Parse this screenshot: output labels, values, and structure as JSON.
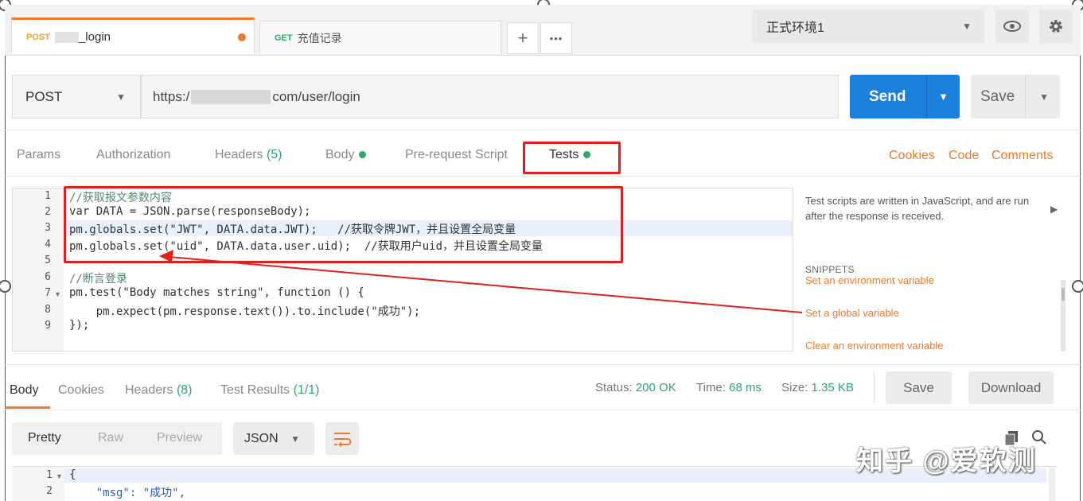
{
  "tabs": [
    {
      "method": "POST",
      "name": "_login",
      "unsaved": true
    },
    {
      "method": "GET",
      "name": "充值记录"
    }
  ],
  "tab_actions": {
    "add": "+",
    "more": "•••"
  },
  "environment": {
    "selected": "正式环境1"
  },
  "request": {
    "method": "POST",
    "url_prefix": "https:/",
    "url_suffix": "com/user/login",
    "send_label": "Send",
    "save_label": "Save"
  },
  "request_tabs": {
    "params": "Params",
    "authorization": "Authorization",
    "headers": "Headers",
    "headers_count": "(5)",
    "body": "Body",
    "prerequest": "Pre-request Script",
    "tests": "Tests"
  },
  "request_links": {
    "cookies": "Cookies",
    "code": "Code",
    "comments": "Comments"
  },
  "editor": {
    "line_numbers": [
      "1",
      "2",
      "3",
      "4",
      "5",
      "6",
      "7",
      "8",
      "9"
    ],
    "lines": [
      "//获取报文参数内容",
      "var DATA = JSON.parse(responseBody);",
      "pm.globals.set(\"JWT\", DATA.data.JWT);   //获取令牌JWT，并且设置全局变量",
      "pm.globals.set(\"uid\", DATA.data.user.uid);  //获取用户uid，并且设置全局变量",
      "",
      "//断言登录",
      "pm.test(\"Body matches string\", function () {",
      "    pm.expect(pm.response.text()).to.include(\"成功\");",
      "});"
    ]
  },
  "side_panel": {
    "description": "Test scripts are written in JavaScript, and are run after the response is received.",
    "snippets_title": "SNIPPETS",
    "snippets": [
      "Set an environment variable",
      "Set a global variable",
      "Clear an environment variable"
    ]
  },
  "response_tabs": {
    "body": "Body",
    "cookies": "Cookies",
    "headers": "Headers",
    "headers_count": "(8)",
    "test_results": "Test Results",
    "test_results_count": "(1/1)"
  },
  "response_status": {
    "status_label": "Status:",
    "status_value": "200 OK",
    "time_label": "Time:",
    "time_value": "68 ms",
    "size_label": "Size:",
    "size_value": "1.35 KB",
    "save_label": "Save",
    "download_label": "Download"
  },
  "response_format": {
    "pretty": "Pretty",
    "raw": "Raw",
    "preview": "Preview",
    "type": "JSON"
  },
  "response_body": {
    "line_numbers": [
      "1",
      "2"
    ],
    "lines": [
      "{",
      "    \"msg\": \"成功\","
    ]
  },
  "watermark": "知乎 @爱软测",
  "colors": {
    "accent": "#f07a2a",
    "send_blue": "#1b7fdc",
    "green": "#2fa86b",
    "annotation_red": "#e0201f"
  }
}
